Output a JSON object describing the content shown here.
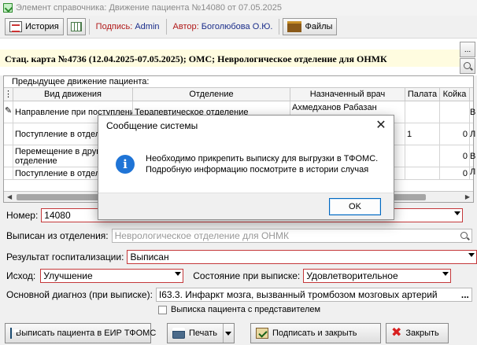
{
  "window": {
    "title": "Элемент справочника: Движение пациента №14080 от 07.05.2025"
  },
  "toolbar": {
    "history_label": "История",
    "signature_label": "Подпись:",
    "signature_value": "Admin",
    "author_label": "Автор:",
    "author_value": "Боголюбова О.Ю.",
    "files_label": "Файлы"
  },
  "card": {
    "title": "Стац. карта №4736 (12.04.2025-07.05.2025); ОМС; Неврологическое отделение для ОНМК",
    "more_button": "...",
    "search_icon": "search-icon"
  },
  "grid": {
    "caption": "Предыдущее движение пациента:",
    "columns": [
      "",
      "Вид движения",
      "Отделение",
      "Назначенный врач",
      "Палата",
      "Койка"
    ],
    "rows": [
      {
        "marker": "✎",
        "type": "Направление при поступлении",
        "dept": "Терапевтическое отделение",
        "doctor": "Ахмедханов Рабазан",
        "ward": "",
        "bed": "",
        "extra": "В"
      },
      {
        "marker": "",
        "type": "Поступление в отделение",
        "dept": "",
        "doctor": "",
        "ward": "1",
        "bed": "0",
        "extra": "Л"
      },
      {
        "marker": "",
        "type": "Перемещение в другое отделение",
        "dept": "",
        "doctor": "",
        "ward": "",
        "bed": "0",
        "extra": "В"
      },
      {
        "marker": "",
        "type": "Поступление в отделение",
        "dept": "",
        "doctor": "",
        "ward": "",
        "bed": "0",
        "extra": "Л"
      }
    ]
  },
  "form": {
    "number_label": "Номер:",
    "number_value": "14080",
    "discharged_from_label": "Выписан из отделения:",
    "discharged_from_value": "Неврологическое отделение для ОНМК",
    "result_label": "Результат госпитализации:",
    "result_value": "Выписан",
    "outcome_label": "Исход:",
    "outcome_value": "Улучшение",
    "state_label": "Состояние при выписке:",
    "state_value": "Удовлетворительное",
    "diagnosis_label": "Основной диагноз (при выписке):",
    "diagnosis_value": "I63.3. Инфаркт мозга, вызванный тромбозом мозговых артерий",
    "diagnosis_more": "...",
    "with_representative_label": "Выписка пациента с представителем"
  },
  "bottom": {
    "discharge_eir_label": "Выписать пациента в ЕИР ТФОМС",
    "print_label": "Печать",
    "sign_close_label": "Подписать и закрыть",
    "close_label": "Закрыть"
  },
  "dialog": {
    "title": "Сообщение системы",
    "message_line1": "Необходимо прикрепить выписку для выгрузки в ТФОМС.",
    "message_line2": "Подробную информацию посмотрите в истории случая",
    "ok_label": "OK",
    "close_glyph": "✕"
  }
}
